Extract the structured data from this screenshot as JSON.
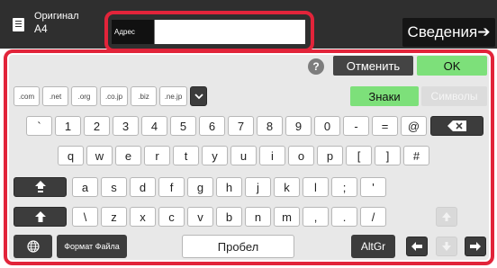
{
  "header": {
    "original_label": "Оригинал",
    "original_size": "A4",
    "address_label": "Адрес",
    "address_value": "",
    "details_label": "Сведения➔"
  },
  "actions": {
    "help": "?",
    "cancel": "Отменить",
    "ok": "OK"
  },
  "domains": [
    ".com",
    ".net",
    ".org",
    ".co.jp",
    ".biz",
    ".ne.jp"
  ],
  "modes": {
    "chars": "Знаки",
    "symbols": "Символы"
  },
  "rows": {
    "row1": [
      "`",
      "1",
      "2",
      "3",
      "4",
      "5",
      "6",
      "7",
      "8",
      "9",
      "0",
      "-",
      "=",
      "@"
    ],
    "row2": [
      "q",
      "w",
      "e",
      "r",
      "t",
      "y",
      "u",
      "i",
      "o",
      "p",
      "[",
      "]",
      "#"
    ],
    "row3": [
      "a",
      "s",
      "d",
      "f",
      "g",
      "h",
      "j",
      "k",
      "l",
      ";",
      "'"
    ],
    "row4": [
      "\\",
      "z",
      "x",
      "c",
      "v",
      "b",
      "n",
      "m",
      ",",
      ".",
      "/"
    ]
  },
  "bottom": {
    "format": "Формат Файла",
    "space": "Пробел",
    "altgr": "AltGr"
  },
  "colors": {
    "highlight": "#e2243a",
    "accent_green": "#7de07a",
    "topbar": "#2f2f2f"
  }
}
